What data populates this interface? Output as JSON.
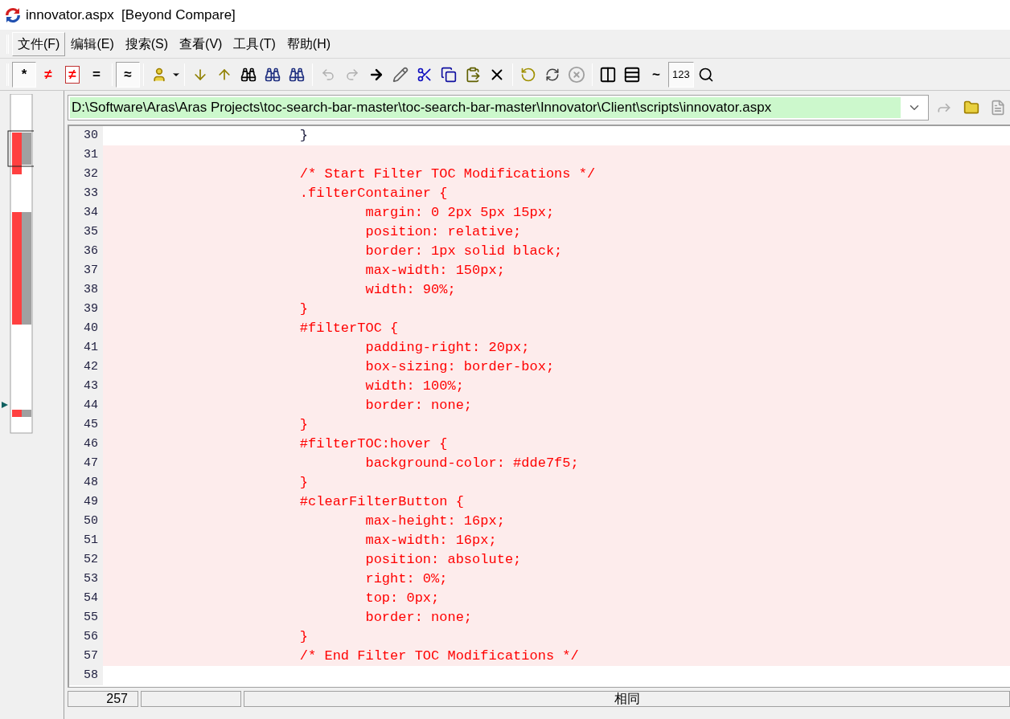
{
  "window": {
    "title": "innovator.aspx  [Beyond Compare]"
  },
  "menu": [
    {
      "label": "文件(F)",
      "selected": true
    },
    {
      "label": "编辑(E)",
      "selected": false
    },
    {
      "label": "搜索(S)",
      "selected": false
    },
    {
      "label": "查看(V)",
      "selected": false
    },
    {
      "label": "工具(T)",
      "selected": false
    },
    {
      "label": "帮助(H)",
      "selected": false
    }
  ],
  "toolbar": {
    "buttons": [
      {
        "label": "*",
        "pressed": true
      },
      {
        "label": "≠",
        "pressed": false
      },
      {
        "label": "≠",
        "pressed": false
      },
      {
        "label": "=",
        "pressed": false
      },
      {
        "label": "≈",
        "pressed": true
      },
      {
        "label": "~",
        "pressed": false
      },
      {
        "label": "123",
        "pressed": true
      }
    ]
  },
  "path": {
    "value": "D:\\Software\\Aras\\Aras Projects\\toc-search-bar-master\\toc-search-bar-master\\Innovator\\Client\\scripts\\innovator.aspx"
  },
  "lines": [
    {
      "number": "30",
      "text": "                        }",
      "changed": false
    },
    {
      "number": "31",
      "changed": true
    },
    {
      "number": "32",
      "text": "                        /* Start Filter TOC Modifications */",
      "changed": true
    },
    {
      "number": "33",
      "text": "                        .filterContainer {",
      "changed": true
    },
    {
      "number": "34",
      "text": "                                margin: 0 2px 5px 15px;",
      "changed": true
    },
    {
      "number": "35",
      "text": "                                position: relative;",
      "changed": true
    },
    {
      "number": "36",
      "text": "                                border: 1px solid black;",
      "changed": true
    },
    {
      "number": "37",
      "text": "                                max-width: 150px;",
      "changed": true
    },
    {
      "number": "38",
      "text": "                                width: 90%;",
      "changed": true
    },
    {
      "number": "39",
      "text": "                        }",
      "changed": true
    },
    {
      "number": "40",
      "text": "                        #filterTOC {",
      "changed": true
    },
    {
      "number": "41",
      "text": "                                padding-right: 20px;",
      "changed": true
    },
    {
      "number": "42",
      "text": "                                box-sizing: border-box;",
      "changed": true
    },
    {
      "number": "43",
      "text": "                                width: 100%;",
      "changed": true
    },
    {
      "number": "44",
      "text": "                                border: none;",
      "changed": true
    },
    {
      "number": "45",
      "text": "                        }",
      "changed": true
    },
    {
      "number": "46",
      "text": "                        #filterTOC:hover {",
      "changed": true
    },
    {
      "number": "47",
      "text": "                                background-color: #dde7f5;",
      "changed": true
    },
    {
      "number": "48",
      "text": "                        }",
      "changed": true
    },
    {
      "number": "49",
      "text": "                        #clearFilterButton {",
      "changed": true
    },
    {
      "number": "50",
      "text": "                                max-height: 16px;",
      "changed": true
    },
    {
      "number": "51",
      "text": "                                max-width: 16px;",
      "changed": true
    },
    {
      "number": "52",
      "text": "                                position: absolute;",
      "changed": true
    },
    {
      "number": "53",
      "text": "                                right: 0%;",
      "changed": true
    },
    {
      "number": "54",
      "text": "                                top: 0px;",
      "changed": true
    },
    {
      "number": "55",
      "text": "                                border: none;",
      "changed": true
    },
    {
      "number": "56",
      "text": "                        }",
      "changed": true
    },
    {
      "number": "57",
      "text": "                        /* End Filter TOC Modifications */",
      "changed": true
    },
    {
      "number": "58",
      "changed": false
    }
  ],
  "status_bar": {
    "line_count": "257",
    "result": "相同"
  }
}
